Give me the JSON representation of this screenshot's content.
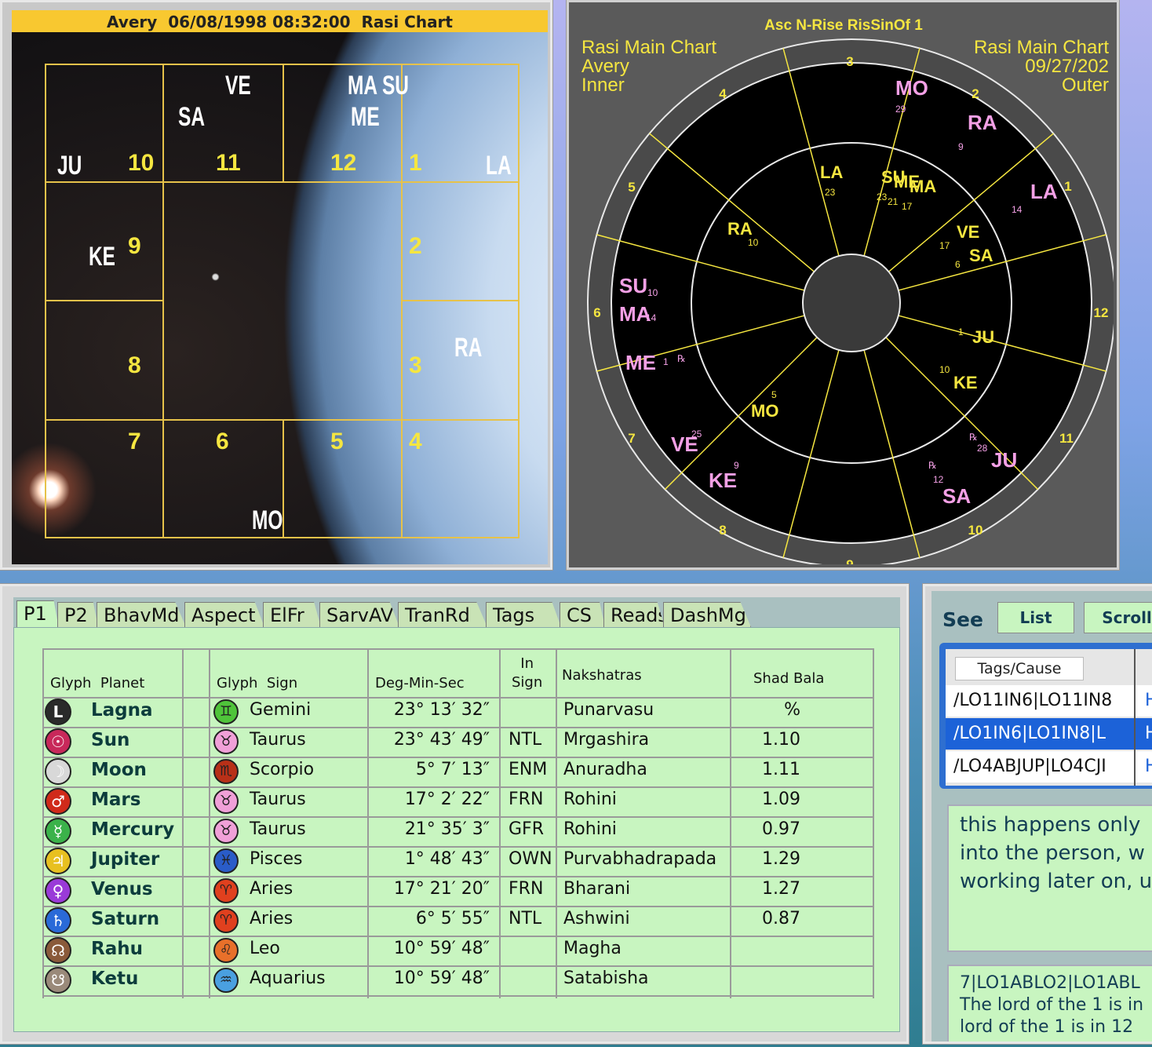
{
  "rasi_chart": {
    "title": "Avery  06/08/1998 08:32:00  Rasi Chart",
    "houses": {
      "h1": "1",
      "h2": "2",
      "h3": "3",
      "h4": "4",
      "h5": "5",
      "h6": "6",
      "h7": "7",
      "h8": "8",
      "h9": "9",
      "h10": "10",
      "h11": "11",
      "h12": "12"
    },
    "planets": {
      "ju": "JU",
      "sa": "SA",
      "ve": "VE",
      "masu": "MA SU",
      "me": "ME",
      "la": "LA",
      "ke": "KE",
      "ra": "RA",
      "mo": "MO"
    }
  },
  "wheel_chart": {
    "title": "Asc N-Rise RisSinOf 1",
    "left_label": [
      "Rasi Main Chart",
      "Avery",
      "Inner"
    ],
    "right_label": [
      "Rasi Main Chart",
      "09/27/202",
      "Outer"
    ],
    "house_numbers": [
      "1",
      "2",
      "3",
      "4",
      "5",
      "6",
      "7",
      "8",
      "9",
      "10",
      "11",
      "12"
    ],
    "inner_planets": [
      {
        "label": "LA",
        "deg": "23"
      },
      {
        "label": "SU",
        "deg": "23"
      },
      {
        "label": "ME",
        "deg": "21"
      },
      {
        "label": "MA",
        "deg": "17"
      },
      {
        "label": "RA",
        "deg": "10"
      },
      {
        "label": "VE",
        "deg": "17"
      },
      {
        "label": "SA",
        "deg": "6"
      },
      {
        "label": "JU",
        "deg": "1"
      },
      {
        "label": "KE",
        "deg": "10"
      },
      {
        "label": "MO",
        "deg": "5"
      }
    ],
    "outer_planets": [
      {
        "label": "MO",
        "deg": "29"
      },
      {
        "label": "RA",
        "deg": "9"
      },
      {
        "label": "LA",
        "deg": "14"
      },
      {
        "label": "SU",
        "deg": "10"
      },
      {
        "label": "MA",
        "deg": "14"
      },
      {
        "label": "ME",
        "deg": "1"
      },
      {
        "label": "VE",
        "deg": "25"
      },
      {
        "label": "KE",
        "deg": "9"
      },
      {
        "label": "SA",
        "deg": "12"
      },
      {
        "label": "JU",
        "deg": "28"
      }
    ],
    "retro_mark": "℞"
  },
  "tabs": [
    "P1",
    "P2",
    "BhavMd",
    "Aspect",
    "ElFr",
    "SarvAV",
    "TranRd",
    "Tags",
    "CS",
    "Reads",
    "DashMg"
  ],
  "table": {
    "headers": {
      "glyph_planet": "Glyph  Planet",
      "glyph_sign": "Glyph  Sign",
      "deg": "Deg-Min-Sec",
      "in_sign": "In\nSign",
      "nakshatras": "Nakshatras",
      "shad_bala": "Shad Bala"
    },
    "rows": [
      {
        "planet": "Lagna",
        "pglyph": "L",
        "pcolor": "#2a2a2a",
        "sign": "Gemini",
        "sglyph": "♊",
        "scolor": "#4fc43a",
        "deg": "23°  13′ 32″",
        "in_sign": "",
        "nak": "Punarvasu",
        "bala": "%"
      },
      {
        "planet": "Sun",
        "pglyph": "☉",
        "pcolor": "#c8285a",
        "sign": "Taurus",
        "sglyph": "♉",
        "scolor": "#f0a0d8",
        "deg": "23°  43′ 49″",
        "in_sign": "NTL",
        "nak": "Mrgashira",
        "bala": "1.10"
      },
      {
        "planet": "Moon",
        "pglyph": "☽",
        "pcolor": "#d8d8d8",
        "sign": "Scorpio",
        "sglyph": "♏",
        "scolor": "#b83018",
        "deg": "5°   7′ 13″",
        "in_sign": "ENM",
        "nak": "Anuradha",
        "bala": "1.11"
      },
      {
        "planet": "Mars",
        "pglyph": "♂",
        "pcolor": "#d02a1a",
        "sign": "Taurus",
        "sglyph": "♉",
        "scolor": "#f0a0d8",
        "deg": "17°   2′ 22″",
        "in_sign": "FRN",
        "nak": "Rohini",
        "bala": "1.09"
      },
      {
        "planet": "Mercury",
        "pglyph": "☿",
        "pcolor": "#3bb24a",
        "sign": "Taurus",
        "sglyph": "♉",
        "scolor": "#f0a0d8",
        "deg": "21°  35′  3″",
        "in_sign": "GFR",
        "nak": "Rohini",
        "bala": "0.97"
      },
      {
        "planet": "Jupiter",
        "pglyph": "♃",
        "pcolor": "#e8c020",
        "sign": "Pisces",
        "sglyph": "♓",
        "scolor": "#2a5cc8",
        "deg": "1°  48′ 43″",
        "in_sign": "OWN",
        "nak": "Purvabhadrapada",
        "bala": "1.29"
      },
      {
        "planet": "Venus",
        "pglyph": "♀",
        "pcolor": "#9a3ad8",
        "sign": "Aries",
        "sglyph": "♈",
        "scolor": "#e0401e",
        "deg": "17°  21′ 20″",
        "in_sign": "FRN",
        "nak": "Bharani",
        "bala": "1.27"
      },
      {
        "planet": "Saturn",
        "pglyph": "♄",
        "pcolor": "#2a6ad8",
        "sign": "Aries",
        "sglyph": "♈",
        "scolor": "#e0401e",
        "deg": "6°   5′ 55″",
        "in_sign": "NTL",
        "nak": "Ashwini",
        "bala": "0.87"
      },
      {
        "planet": "Rahu",
        "pglyph": "☊",
        "pcolor": "#8a5a3a",
        "sign": "Leo",
        "sglyph": "♌",
        "scolor": "#e8702a",
        "deg": "10°  59′ 48″",
        "in_sign": "",
        "nak": "Magha",
        "bala": ""
      },
      {
        "planet": "Ketu",
        "pglyph": "☋",
        "pcolor": "#9a8a7a",
        "sign": "Aquarius",
        "sglyph": "♒",
        "scolor": "#4aa0e0",
        "deg": "10°  59′ 48″",
        "in_sign": "",
        "nak": "Satabisha",
        "bala": ""
      }
    ]
  },
  "see_panel": {
    "label": "See",
    "list_button": "List",
    "scroll_button": "Scroll",
    "tags_header": "Tags/Cause",
    "tags": [
      {
        "text": "/LO11IN6|LO11IN8",
        "h": "H",
        "selected": false
      },
      {
        "text": "/LO1IN6|LO1IN8|L",
        "h": "H",
        "selected": true
      },
      {
        "text": "/LO4ABJUP|LO4CJI",
        "h": "H",
        "selected": false
      }
    ],
    "note_lines": [
      "this happens only",
      "into the person, w",
      "working later on, u"
    ],
    "rule_lines": [
      "7|LO1ABLO2|LO1ABL",
      "The lord of the 1 is in",
      "lord of the 1 is in 12"
    ]
  }
}
